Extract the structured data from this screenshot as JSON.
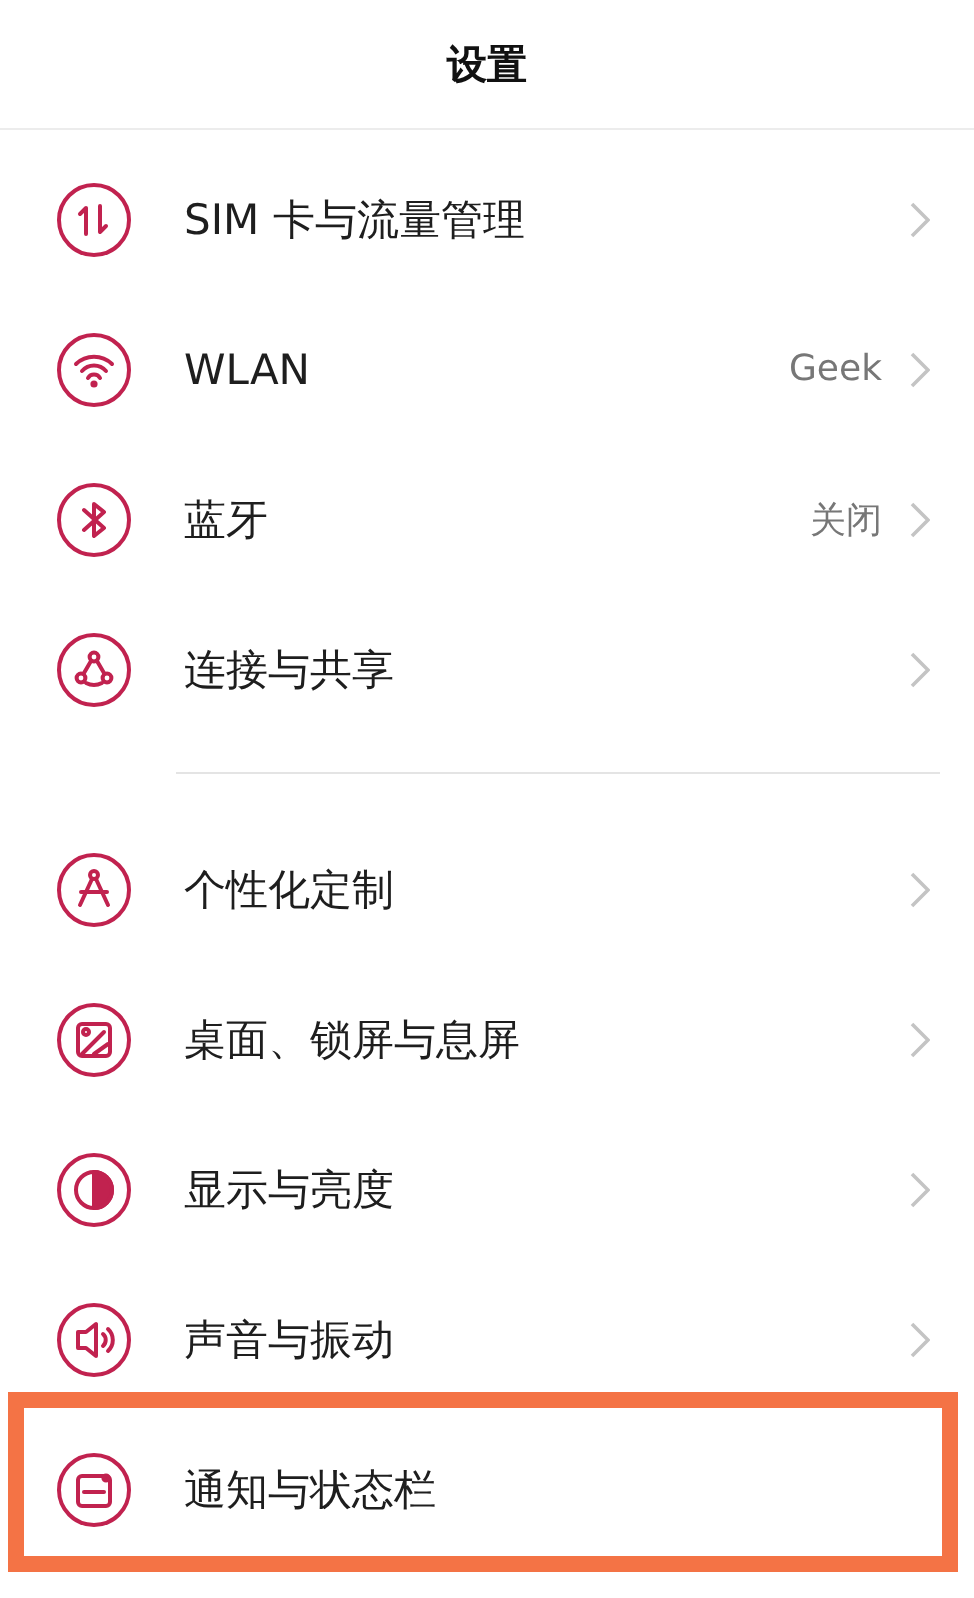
{
  "header": {
    "title": "设置"
  },
  "groups": [
    {
      "items": [
        {
          "label": "SIM 卡与流量管理",
          "chevron": true,
          "highlighted": false
        },
        {
          "label": "WLAN",
          "value": "Geek",
          "chevron": true,
          "highlighted": false
        },
        {
          "label": "蓝牙",
          "value": "关闭",
          "chevron": true,
          "highlighted": false
        },
        {
          "label": "连接与共享",
          "chevron": true,
          "highlighted": false
        }
      ]
    },
    {
      "items": [
        {
          "label": "个性化定制",
          "chevron": true,
          "highlighted": false
        },
        {
          "label": "桌面、锁屏与息屏",
          "chevron": true,
          "highlighted": false
        },
        {
          "label": "显示与亮度",
          "chevron": true,
          "highlighted": false
        },
        {
          "label": "声音与振动",
          "chevron": true,
          "highlighted": false
        },
        {
          "label": "通知与状态栏",
          "chevron": false,
          "highlighted": true
        }
      ]
    }
  ]
}
